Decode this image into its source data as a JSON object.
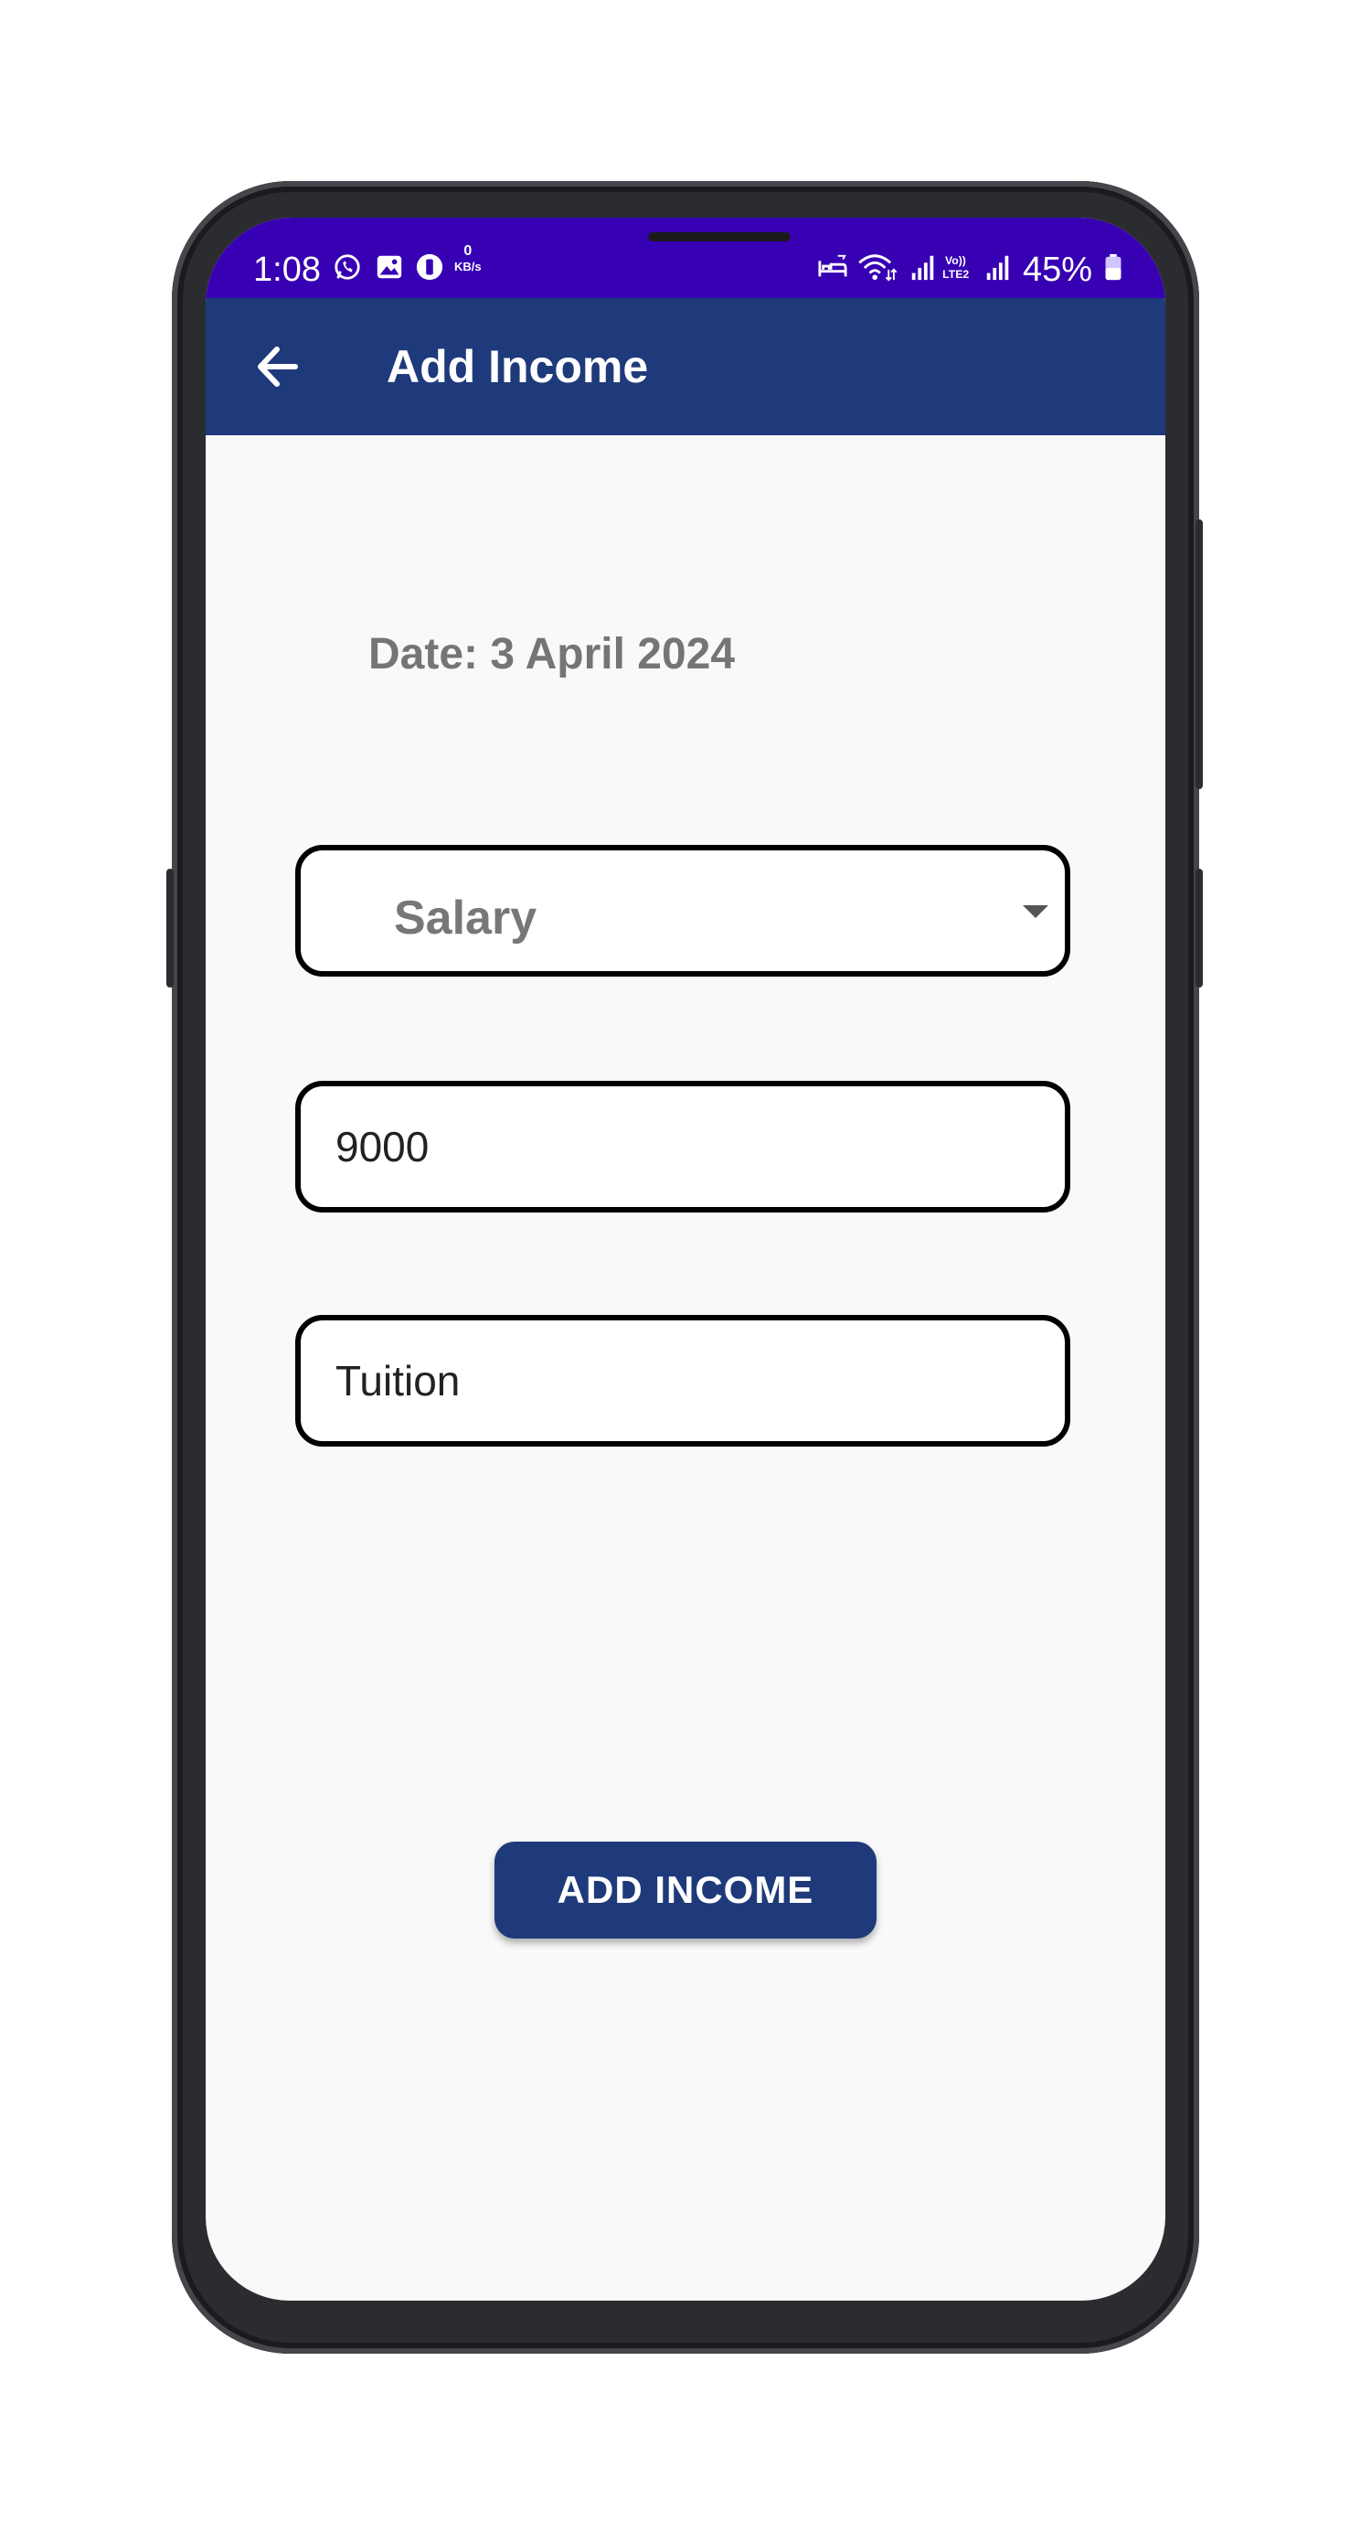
{
  "status_bar": {
    "time": "1:08",
    "speed_value": "0",
    "speed_unit": "KB/s",
    "battery": "45%",
    "icons": [
      "whatsapp-icon",
      "gallery-icon",
      "notification-icon",
      "bed-icon",
      "wifi-icon",
      "signal-icon",
      "volte-icon",
      "signal-icon",
      "battery-icon"
    ]
  },
  "app_bar": {
    "title": "Add Income",
    "back_icon": "arrow-left-icon"
  },
  "form": {
    "date_text": "Date: 3 April 2024",
    "category_selected": "Salary",
    "amount_value": "9000",
    "note_value": "Tuition"
  },
  "actions": {
    "add_label": "ADD INCOME"
  },
  "colors": {
    "status_bar": "#3700b3",
    "app_bar": "#1e3a7a",
    "button": "#1e3a7a",
    "background": "#f9f9f9"
  }
}
